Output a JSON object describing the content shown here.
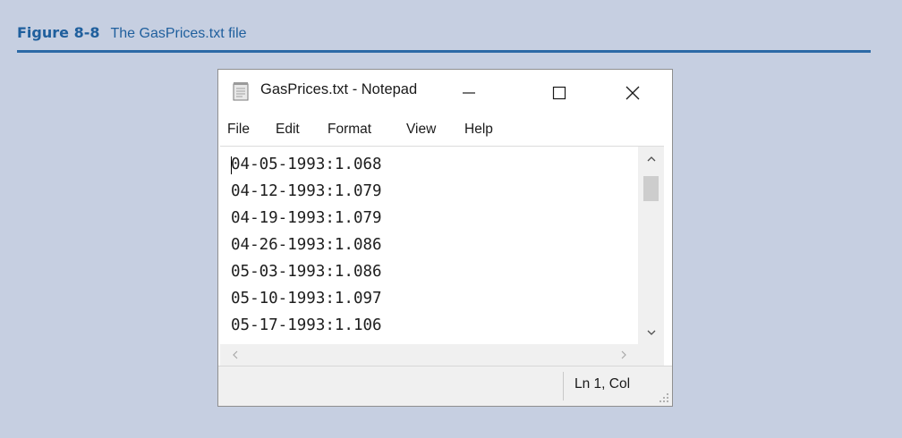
{
  "caption": {
    "number": "Figure 8-8",
    "text": "The GasPrices.txt file"
  },
  "window": {
    "title": "GasPrices.txt - Notepad",
    "icon": "notepad-icon",
    "controls": {
      "minimize": "minimize-icon",
      "maximize": "maximize-icon",
      "close": "close-icon"
    }
  },
  "menu": [
    "File",
    "Edit",
    "Format",
    "View",
    "Help"
  ],
  "editor": {
    "lines": [
      "04-05-1993:1.068",
      "04-12-1993:1.079",
      "04-19-1993:1.079",
      "04-26-1993:1.086",
      "05-03-1993:1.086",
      "05-10-1993:1.097",
      "05-17-1993:1.106"
    ]
  },
  "status": {
    "position": "Ln 1, Col"
  },
  "colors": {
    "page_background": "#c6cfe1",
    "caption_color": "#1f5f9d",
    "rule_color": "#2c6aa6"
  }
}
